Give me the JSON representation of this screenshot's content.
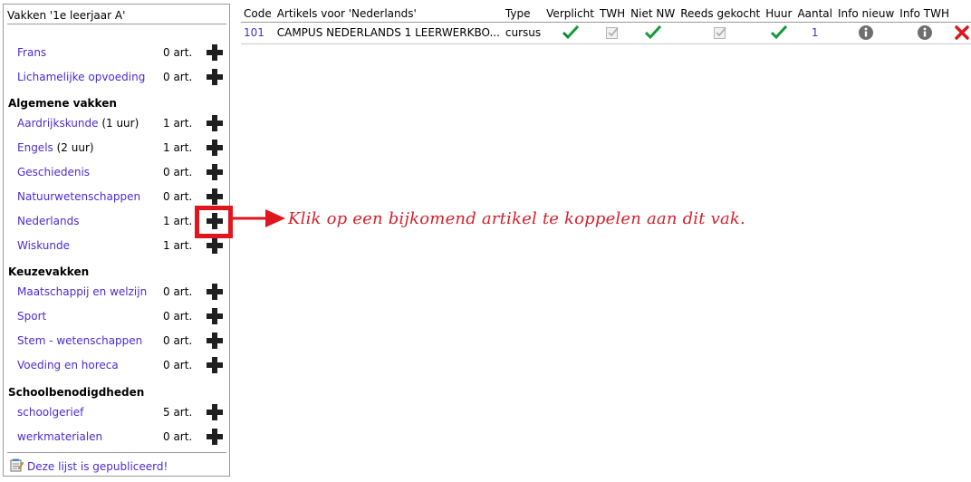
{
  "panel": {
    "title": "Vakken '1e leerjaar A'",
    "ungrouped": [
      {
        "subject": "Frans",
        "hours": "",
        "count": "0 art."
      },
      {
        "subject": "Lichamelijke opvoeding",
        "hours": "",
        "count": "0 art."
      }
    ],
    "groups": [
      {
        "heading": "Algemene vakken",
        "items": [
          {
            "subject": "Aardrijkskunde",
            "hours": " (1 uur)",
            "count": "1 art."
          },
          {
            "subject": "Engels",
            "hours": " (2 uur)",
            "count": "1 art."
          },
          {
            "subject": "Geschiedenis",
            "hours": "",
            "count": "0 art."
          },
          {
            "subject": "Natuurwetenschappen",
            "hours": "",
            "count": "0 art."
          },
          {
            "subject": "Nederlands",
            "hours": "",
            "count": "1 art."
          },
          {
            "subject": "Wiskunde",
            "hours": "",
            "count": "1 art."
          }
        ]
      },
      {
        "heading": "Keuzevakken",
        "items": [
          {
            "subject": "Maatschappij en welzijn",
            "hours": "",
            "count": "0 art."
          },
          {
            "subject": "Sport",
            "hours": "",
            "count": "0 art."
          },
          {
            "subject": "Stem - wetenschappen",
            "hours": "",
            "count": "0 art."
          },
          {
            "subject": "Voeding en horeca",
            "hours": "",
            "count": "0 art."
          }
        ]
      },
      {
        "heading": "Schoolbenodigdheden",
        "items": [
          {
            "subject": "schoolgerief",
            "hours": "",
            "count": "5 art."
          },
          {
            "subject": "werkmaterialen",
            "hours": "",
            "count": "0 art."
          }
        ]
      }
    ],
    "published_link": "Deze lijst is gepubliceerd!"
  },
  "annotation": "Klik op een bijkomend artikel te koppelen aan dit vak.",
  "table": {
    "headers": {
      "code": "Code",
      "article": "Artikels voor 'Nederlands'",
      "type": "Type",
      "mandatory": "Verplicht",
      "twh": "TWH",
      "not_nw": "Niet NW",
      "already_bought": "Reeds gekocht",
      "rent": "Huur",
      "amount": "Aantal",
      "info_new": "Info nieuw",
      "info_twh": "Info TWH"
    },
    "rows": [
      {
        "code": "101",
        "article": "CAMPUS NEDERLANDS 1 LEERWERKBO...",
        "type": "cursus",
        "mandatory": "checked",
        "twh": "unchecked-disabled",
        "not_nw": "checked",
        "already_bought": "unchecked-disabled",
        "rent": "checked",
        "amount": "1"
      }
    ]
  },
  "colors": {
    "link": "#4b2ccf",
    "check_green": "#139a3a",
    "annotation_red": "#d3212d",
    "delete_red": "#e0161e",
    "info_grey": "#6f6f6f"
  },
  "icons": {
    "add": "plus-icon",
    "published": "notepad-icon",
    "checked": "green-check-icon",
    "disabled": "grey-check-icon",
    "info": "info-icon",
    "delete": "red-x-icon"
  }
}
